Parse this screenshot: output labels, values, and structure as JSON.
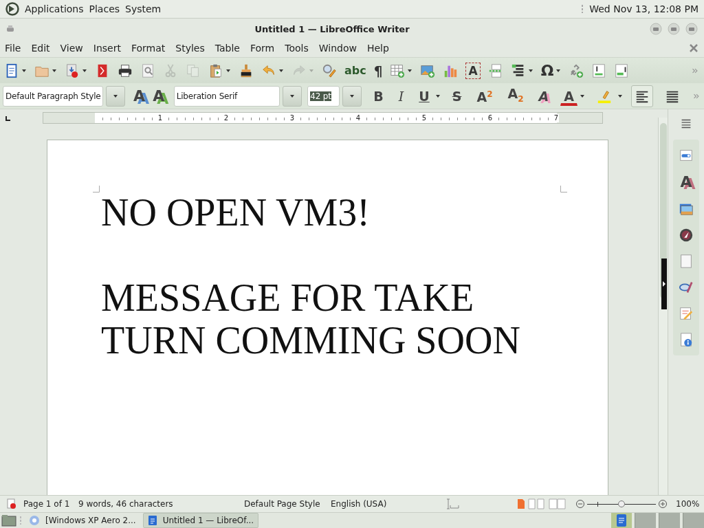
{
  "top_panel": {
    "menus": [
      "Applications",
      "Places",
      "System"
    ],
    "clock": "Wed Nov 13, 12:08 PM"
  },
  "window": {
    "title": "Untitled 1 — LibreOffice Writer"
  },
  "menu_bar": [
    "File",
    "Edit",
    "View",
    "Insert",
    "Format",
    "Styles",
    "Table",
    "Form",
    "Tools",
    "Window",
    "Help"
  ],
  "standard_toolbar": [
    {
      "kind": "new",
      "disabled": false
    },
    {
      "kind": "open",
      "disabled": false
    },
    {
      "kind": "save",
      "disabled": false
    },
    {
      "kind": "pdf",
      "disabled": false
    },
    {
      "kind": "print",
      "disabled": false
    },
    {
      "kind": "preview",
      "disabled": false
    },
    {
      "kind": "cut",
      "disabled": true
    },
    {
      "kind": "copy",
      "disabled": true
    },
    {
      "kind": "paste",
      "disabled": false
    },
    {
      "kind": "clone",
      "disabled": false
    },
    {
      "kind": "undo",
      "disabled": false
    },
    {
      "kind": "redo",
      "disabled": true
    },
    {
      "kind": "find",
      "disabled": false
    },
    {
      "kind": "spelling",
      "glyph": "abc",
      "disabled": false
    },
    {
      "kind": "formatting-marks",
      "glyph": "¶",
      "disabled": false
    },
    {
      "kind": "table",
      "disabled": false
    },
    {
      "kind": "image",
      "disabled": false
    },
    {
      "kind": "chart",
      "disabled": false
    },
    {
      "kind": "textbox",
      "glyph": "A",
      "disabled": false
    },
    {
      "kind": "pagebreak",
      "disabled": false
    },
    {
      "kind": "field",
      "disabled": false
    },
    {
      "kind": "special-character",
      "glyph": "Ω",
      "disabled": false
    },
    {
      "kind": "link",
      "disabled": false
    },
    {
      "kind": "footnote",
      "disabled": false
    },
    {
      "kind": "comment",
      "disabled": false
    }
  ],
  "formatting_toolbar": {
    "paragraph_style": {
      "value": "Default Paragraph Style"
    },
    "style_buttons": [
      {
        "kind": "update-style",
        "glyph": "A"
      },
      {
        "kind": "new-style",
        "glyph": "A"
      }
    ],
    "font_name": {
      "value": "Liberation Serif"
    },
    "font_size": {
      "value": "42 pt",
      "highlighted": true
    },
    "buttons": [
      {
        "kind": "bold",
        "glyph": "B",
        "selected": false
      },
      {
        "kind": "italic",
        "glyph": "I",
        "selected": false
      },
      {
        "kind": "underline",
        "glyph": "U",
        "selected": false
      },
      {
        "kind": "strikethrough",
        "glyph": "S",
        "selected": false
      },
      {
        "kind": "superscript",
        "glyph": "A$^{2}$",
        "selected": false
      },
      {
        "kind": "subscript",
        "glyph": "A$_{2}$",
        "selected": false
      },
      {
        "kind": "clear",
        "glyph": "A",
        "selected": false
      },
      {
        "kind": "font-color",
        "glyph": "A",
        "selected": false
      },
      {
        "kind": "highlight",
        "selected": false
      },
      {
        "kind": "align-left",
        "selected": true
      },
      {
        "kind": "justify",
        "selected": false
      }
    ]
  },
  "ruler": {
    "labels": [
      "1",
      "2",
      "3",
      "4",
      "5",
      "6",
      "7"
    ]
  },
  "document": {
    "paragraphs": [
      "NO OPEN VM3!",
      "MESSAGE FOR TAKE TURN COMMING SOON"
    ]
  },
  "sidebar": [
    {
      "kind": "menu"
    },
    {
      "kind": "properties"
    },
    {
      "kind": "styles",
      "glyph": "A"
    },
    {
      "kind": "gallery"
    },
    {
      "kind": "navigator"
    },
    {
      "kind": "page"
    },
    {
      "kind": "changes"
    },
    {
      "kind": "design"
    },
    {
      "kind": "accessibility"
    }
  ],
  "status_bar": {
    "page": "Page 1 of 1",
    "words": "9 words, 46 characters",
    "page_style": "Default Page Style",
    "language": "English (USA)",
    "zoom": {
      "level": 0.5,
      "reading": "100%"
    }
  },
  "taskbar": [
    {
      "label": "[Windows XP Aero 2...",
      "selected": false
    },
    {
      "label": "Untitled 1 — LibreOf...",
      "selected": true
    }
  ]
}
